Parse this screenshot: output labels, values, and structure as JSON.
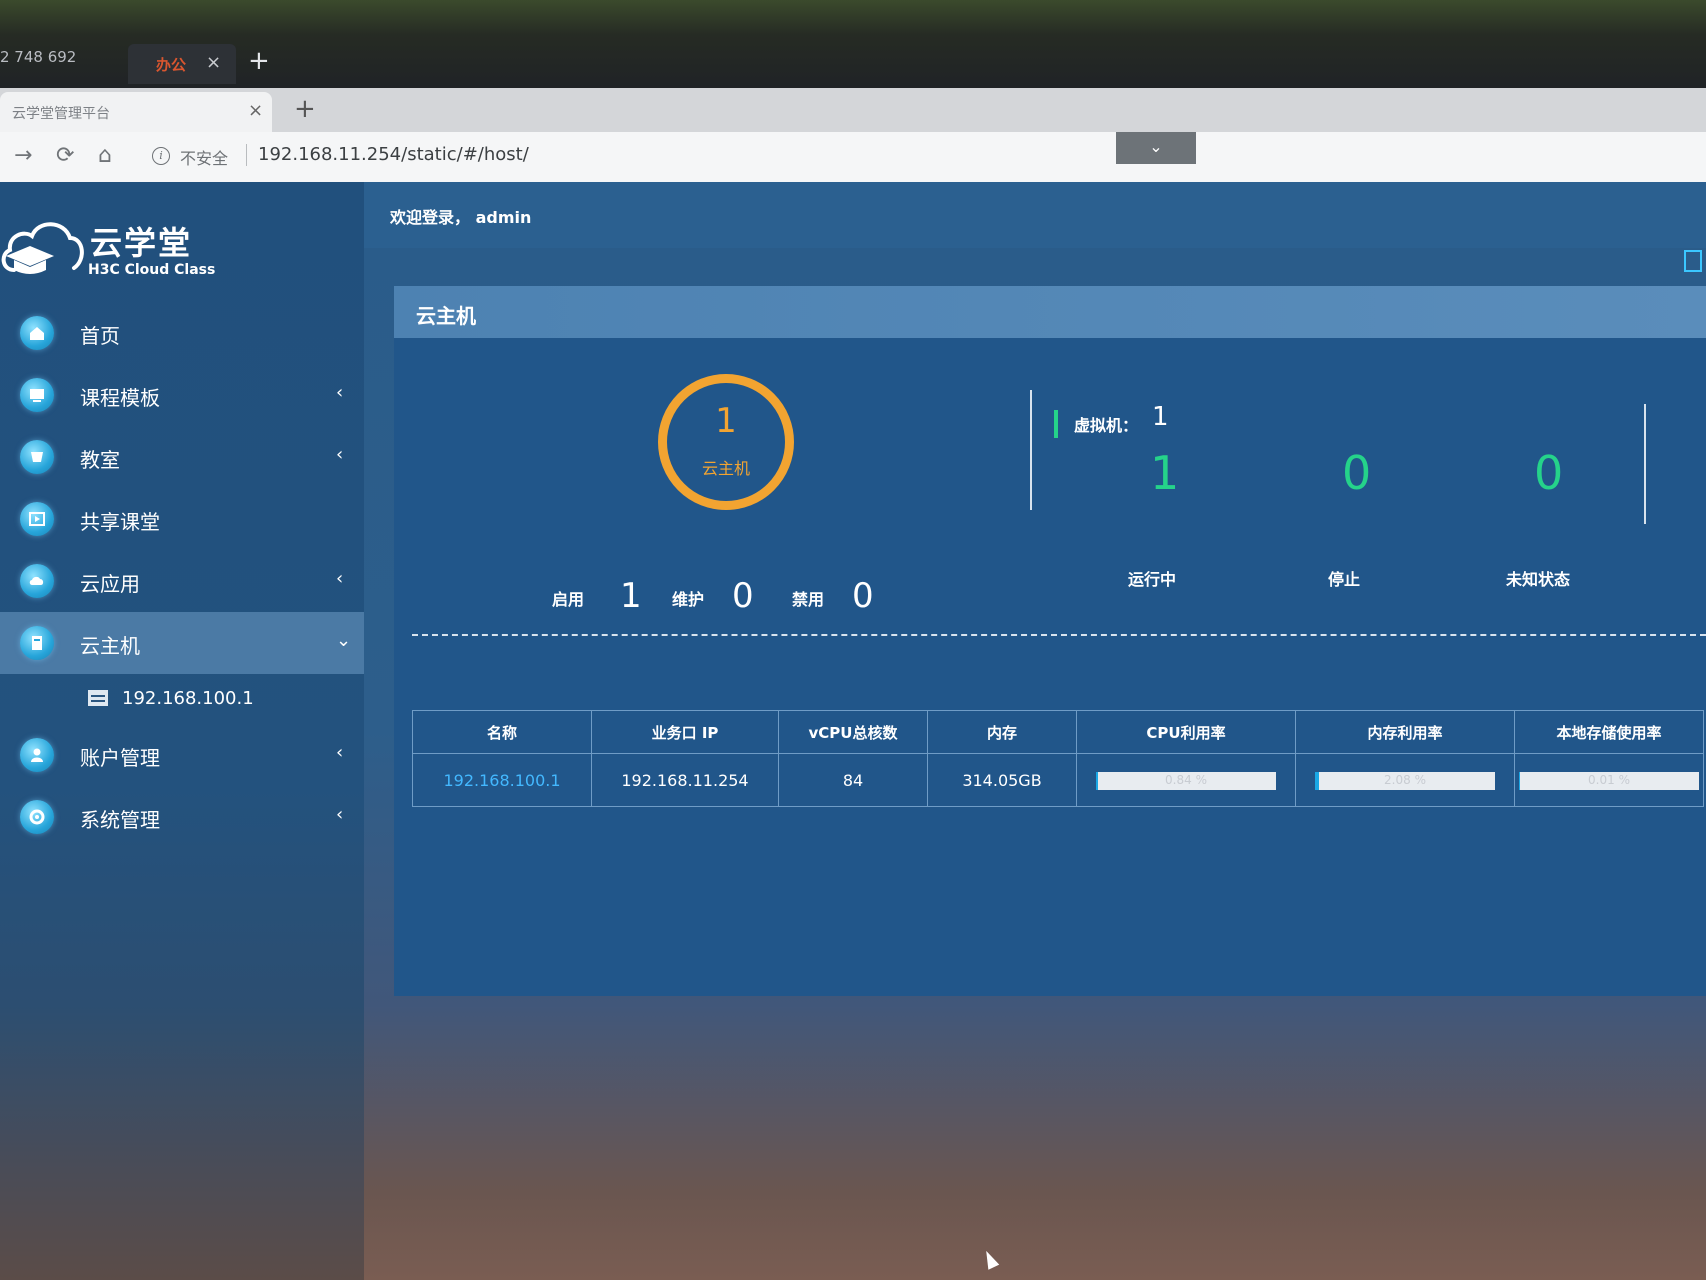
{
  "outer": {
    "counter": "2 748 692",
    "tab_label": "办公",
    "tab_close": "×",
    "new_tab": "+"
  },
  "browser": {
    "tab_title": "云学堂管理平台",
    "tab_close": "×",
    "new_tab": "+",
    "nav": {
      "forward": "→",
      "reload": "⟳",
      "home": "⌂"
    },
    "info_icon": "i",
    "insecure_label": "不安全",
    "url": "192.168.11.254/static/#/host/",
    "dropdown": "⌄"
  },
  "sidebar": {
    "logo_title": "云学堂",
    "logo_sub": "H3C Cloud Class",
    "items": [
      {
        "label": "首页",
        "icon": "home-icon",
        "chevron": ""
      },
      {
        "label": "课程模板",
        "icon": "template-icon",
        "chevron": "‹"
      },
      {
        "label": "教室",
        "icon": "classroom-icon",
        "chevron": "‹"
      },
      {
        "label": "共享课堂",
        "icon": "share-icon",
        "chevron": ""
      },
      {
        "label": "云应用",
        "icon": "cloud-app-icon",
        "chevron": "‹"
      },
      {
        "label": "云主机",
        "icon": "host-icon",
        "chevron": "⌄"
      },
      {
        "label": "账户管理",
        "icon": "account-icon",
        "chevron": "‹"
      },
      {
        "label": "系统管理",
        "icon": "settings-icon",
        "chevron": "‹"
      }
    ],
    "sub_item": "192.168.100.1"
  },
  "header": {
    "welcome": "欢迎登录， admin"
  },
  "panel": {
    "title": "云主机",
    "host_count": "1",
    "host_count_label": "云主机",
    "status": {
      "enabled_label": "启用",
      "enabled": "1",
      "maintenance_label": "维护",
      "maintenance": "0",
      "disabled_label": "禁用",
      "disabled": "0"
    },
    "vm": {
      "label": "虚拟机：",
      "total": "1",
      "running": "1",
      "running_label": "运行中",
      "stopped": "0",
      "stopped_label": "停止",
      "unknown": "0",
      "unknown_label": "未知状态"
    },
    "table": {
      "headers": [
        "名称",
        "业务口 IP",
        "vCPU总核数",
        "内存",
        "CPU利用率",
        "内存利用率",
        "本地存储使用率"
      ],
      "rows": [
        {
          "name": "192.168.100.1",
          "ip": "192.168.11.254",
          "vcpu": "84",
          "memory": "314.05GB",
          "cpu_usage": "0.84 %",
          "cpu_usage_pct": 0.84,
          "mem_usage": "2.08 %",
          "mem_usage_pct": 2.08,
          "storage_usage": "0.01 %",
          "storage_usage_pct": 0.01
        }
      ]
    }
  },
  "colors": {
    "accent_orange": "#f2a431",
    "accent_green": "#25d38a",
    "link_blue": "#43b8ff",
    "bar_fill": "#1aa8e6"
  }
}
